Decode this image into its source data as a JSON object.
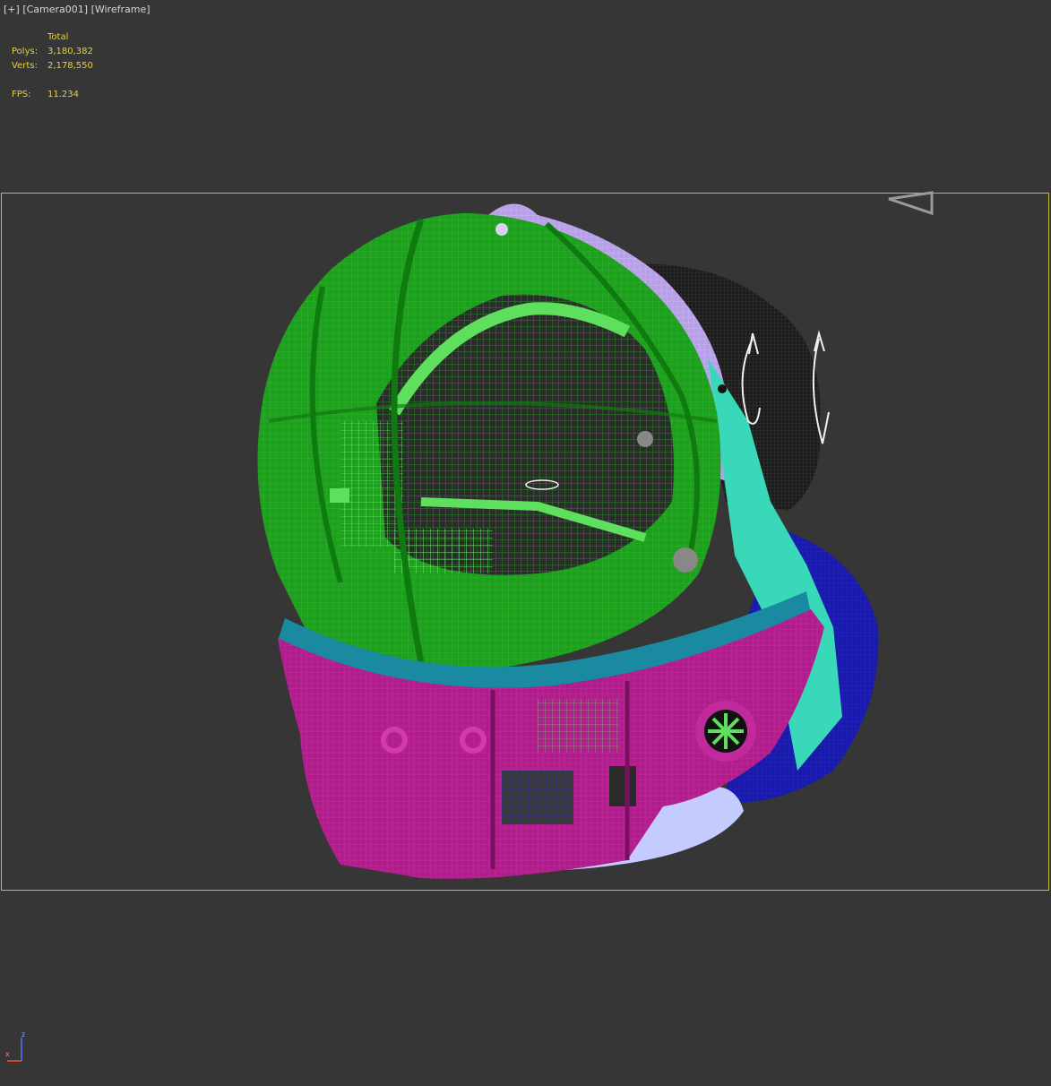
{
  "viewport": {
    "plus_menu": "[+]",
    "camera_menu": "[Camera001]",
    "shading_menu": "[Wireframe]"
  },
  "stats": {
    "header": "Total",
    "polys_label": "Polys:",
    "polys_value": "3,180,382",
    "verts_label": "Verts:",
    "verts_value": "2,178,550",
    "fps_label": "FPS:",
    "fps_value": "11.234"
  },
  "axis": {
    "z": "z",
    "x": "x"
  },
  "colors": {
    "background": "#363636",
    "safe_frame": "#c8b82a",
    "stats_text": "#e6d23c",
    "helmet_dome": "#1f9e1f",
    "helmet_inner": "#5ee05e",
    "neck_ring": "#1a8aa0",
    "collar": "#b01e8c",
    "lavender": "#b8a0e8",
    "navy": "#1a1aa8",
    "dark_pad": "#1c1c1c",
    "teal": "#38d8b8"
  }
}
